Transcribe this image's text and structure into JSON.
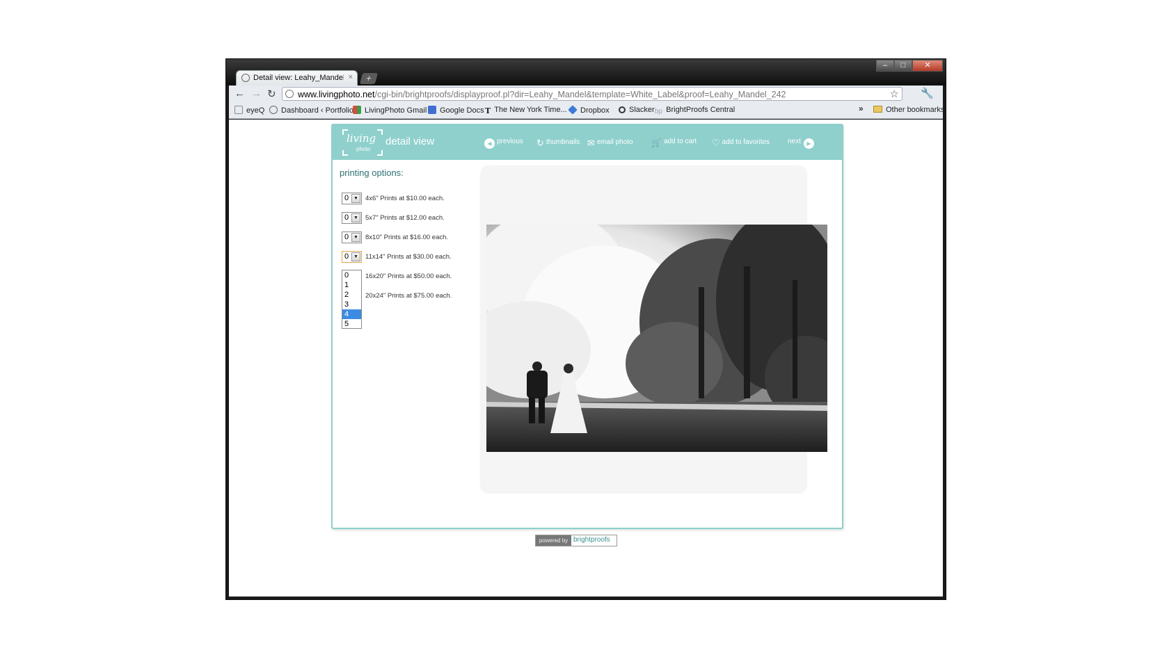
{
  "browser": {
    "tab_title": "Detail view: Leahy_Mandel_",
    "tab_close": "×",
    "new_tab": "+",
    "window_controls": {
      "minimize": "–",
      "maximize": "□",
      "close": "✕"
    },
    "nav": {
      "back": "←",
      "forward": "→",
      "reload": "↻"
    },
    "url_domain": "www.livingphoto.net",
    "url_path": "/cgi-bin/brightproofs/displayproof.pl?dir=Leahy_Mandel&template=White_Label&proof=Leahy_Mandel_242",
    "star": "☆",
    "wrench": "🔧",
    "bookmarks": [
      {
        "label": "eyeQ",
        "color": "#888888"
      },
      {
        "label": "Dashboard ‹ Portfolio",
        "color": "#666666"
      },
      {
        "label": "LivingPhoto Gmail",
        "color": "#d64b3a"
      },
      {
        "label": "Google Docs",
        "color": "#3f6fd1"
      },
      {
        "label": "The New York Time...",
        "color": "#111111"
      },
      {
        "label": "Dropbox",
        "color": "#3d7cd6"
      },
      {
        "label": "Slacker",
        "color": "#333333"
      },
      {
        "label": "BrightProofs Central",
        "color": "#9aa7b5"
      }
    ],
    "bookmarks_more": "»",
    "other_bookmarks": "Other bookmarks"
  },
  "page": {
    "logo_text": "living",
    "logo_sub": "photo",
    "title": "detail view",
    "nav": {
      "previous": "previous",
      "thumbnails": "thumbnails",
      "email_photo": "email photo",
      "add_to_cart": "add to cart",
      "add_to_favorites": "add to favorites",
      "next": "next"
    },
    "printing_options_label": "printing options:",
    "options": [
      {
        "qty": "0",
        "text": "4x6\" Prints at $10.00 each."
      },
      {
        "qty": "0",
        "text": "5x7\" Prints at $12.00 each."
      },
      {
        "qty": "0",
        "text": "8x10\" Prints at $16.00 each."
      },
      {
        "qty": "0",
        "text": "11x14\" Prints at $30.00 each."
      },
      {
        "qty": "",
        "text": "16x20\" Prints at $50.00 each."
      },
      {
        "qty": "",
        "text": "20x24\" Prints at $75.00 each."
      }
    ],
    "dropdown_options": [
      "0",
      "1",
      "2",
      "3",
      "4",
      "5"
    ],
    "dropdown_highlighted": "4",
    "powered_by": "powered by",
    "powered_brand": "brightproofs",
    "colors": {
      "header": "#8fd0cd",
      "accent_text": "#2d7070",
      "highlight": "#3c8be3"
    }
  }
}
